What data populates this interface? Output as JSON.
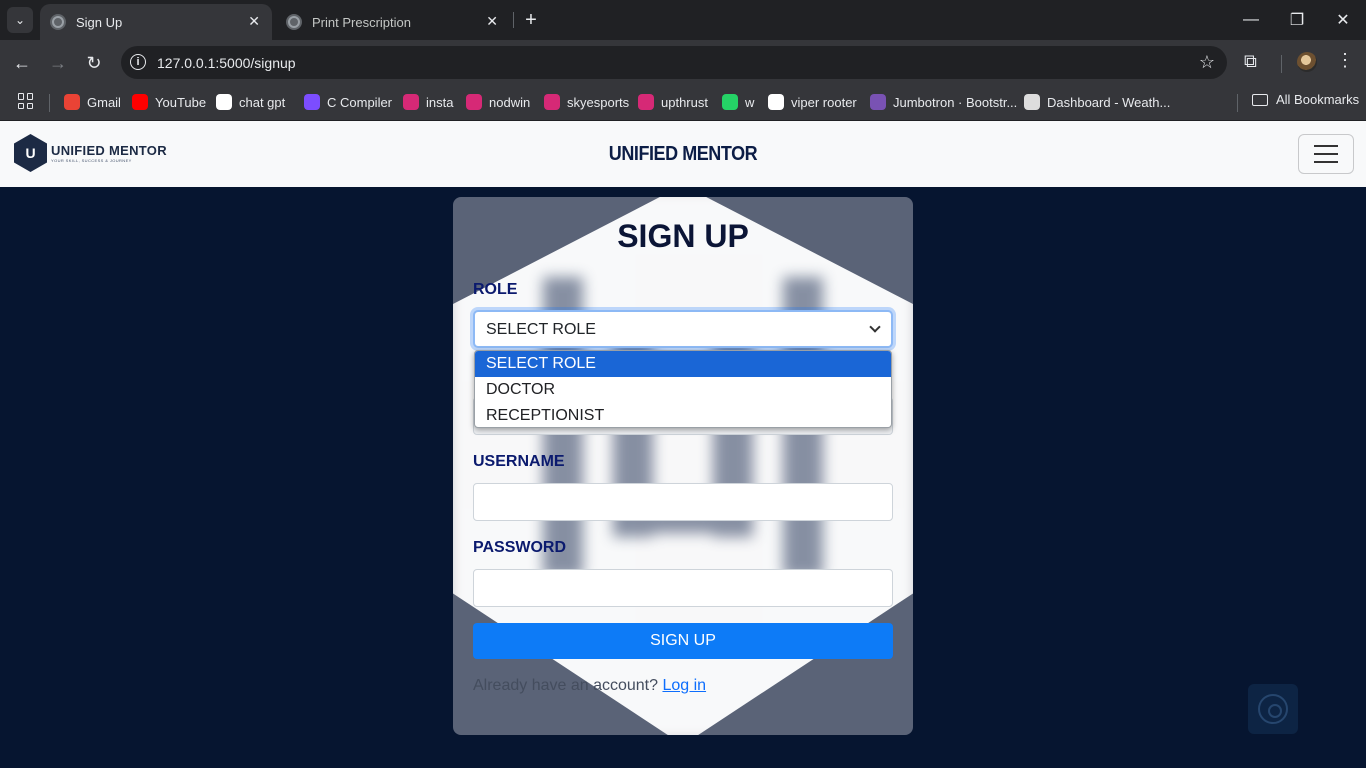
{
  "browser": {
    "tabs": [
      {
        "label": "Sign Up",
        "active": true
      },
      {
        "label": "Print Prescription",
        "active": false
      }
    ],
    "url": "127.0.0.1:5000/signup",
    "bookmarks": [
      {
        "label": "Gmail",
        "icon": "gmail-icon",
        "color": "#ea4335"
      },
      {
        "label": "YouTube",
        "icon": "youtube-icon",
        "color": "#ff0000"
      },
      {
        "label": "chat gpt",
        "icon": "chatgpt-icon",
        "color": "#ffffff"
      },
      {
        "label": "C Compiler",
        "icon": "compiler-icon",
        "color": "#7c4dff"
      },
      {
        "label": "insta",
        "icon": "instagram-icon",
        "color": "#d62976"
      },
      {
        "label": "nodwin",
        "icon": "instagram-icon",
        "color": "#d62976"
      },
      {
        "label": "skyesports",
        "icon": "instagram-icon",
        "color": "#d62976"
      },
      {
        "label": "upthrust",
        "icon": "instagram-icon",
        "color": "#d62976"
      },
      {
        "label": "w",
        "icon": "whatsapp-icon",
        "color": "#25d366"
      },
      {
        "label": "viper rooter",
        "icon": "link-icon",
        "color": "#ffffff"
      },
      {
        "label": "Jumbotron · Bootstr...",
        "icon": "bootstrap-icon",
        "color": "#7952b3"
      },
      {
        "label": "Dashboard - Weath...",
        "icon": "page-icon",
        "color": "#dddddd"
      }
    ],
    "all_bookmarks": "All Bookmarks"
  },
  "navbar": {
    "logo_name": "UNIFIED MENTOR",
    "logo_tagline": "YOUR SKILL, SUCCESS & JOURNEY",
    "brand": "UNIFIED MENTOR"
  },
  "form": {
    "title": "SIGN UP",
    "role_label": "ROLE",
    "role_selected": "SELECT ROLE",
    "role_options": [
      "SELECT ROLE",
      "DOCTOR",
      "RECEPTIONIST"
    ],
    "username_label": "USERNAME",
    "username_value": "",
    "password_label": "PASSWORD",
    "password_value": "",
    "submit_label": "SIGN UP",
    "login_prompt": "Already have an account?",
    "login_link": "Log in"
  },
  "colors": {
    "page_bg": "#061530",
    "card_bg": "#5a6377",
    "accent": "#0d7bf7",
    "label": "#0b1a6e"
  }
}
